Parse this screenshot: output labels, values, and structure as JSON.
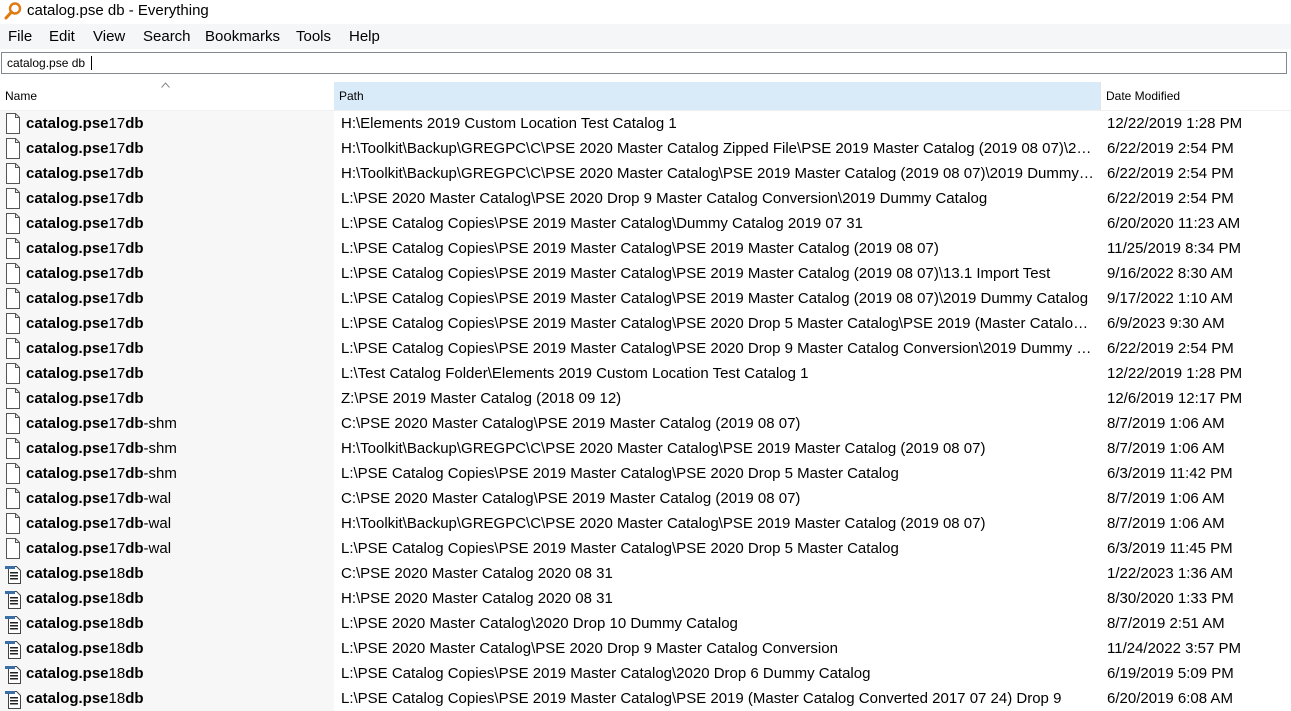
{
  "window": {
    "title": "catalog.pse db - Everything"
  },
  "menu": [
    "File",
    "Edit",
    "View",
    "Search",
    "Bookmarks",
    "Tools",
    "Help"
  ],
  "search": {
    "value": "catalog.pse db"
  },
  "columns": {
    "name": "Name",
    "path": "Path",
    "date": "Date Modified"
  },
  "sort": {
    "column": "Name",
    "direction": "ascending"
  },
  "icons": {
    "app": "magnifier-icon",
    "file": "file-icon",
    "db_file": "database-file-icon"
  },
  "rows": [
    {
      "prefix": "catalog.pse",
      "mid": "17",
      "suffix": "db",
      "tail": "",
      "icon": "file",
      "path": "H:\\Elements 2019 Custom Location Test Catalog 1",
      "date": "12/22/2019 1:28 PM"
    },
    {
      "prefix": "catalog.pse",
      "mid": "17",
      "suffix": "db",
      "tail": "",
      "icon": "file",
      "path": "H:\\Toolkit\\Backup\\GREGPC\\C\\PSE 2020 Master Catalog Zipped File\\PSE 2019 Master Catalog (2019 08 07)\\2019 ...",
      "date": "6/22/2019 2:54 PM"
    },
    {
      "prefix": "catalog.pse",
      "mid": "17",
      "suffix": "db",
      "tail": "",
      "icon": "file",
      "path": "H:\\Toolkit\\Backup\\GREGPC\\C\\PSE 2020 Master Catalog\\PSE 2019 Master Catalog (2019 08 07)\\2019 Dummy Cat...",
      "date": "6/22/2019 2:54 PM"
    },
    {
      "prefix": "catalog.pse",
      "mid": "17",
      "suffix": "db",
      "tail": "",
      "icon": "file",
      "path": "L:\\PSE 2020 Master Catalog\\PSE 2020 Drop 9 Master Catalog Conversion\\2019 Dummy Catalog",
      "date": "6/22/2019 2:54 PM"
    },
    {
      "prefix": "catalog.pse",
      "mid": "17",
      "suffix": "db",
      "tail": "",
      "icon": "file",
      "path": "L:\\PSE Catalog Copies\\PSE 2019 Master Catalog\\Dummy Catalog 2019 07 31",
      "date": "6/20/2020 11:23 AM"
    },
    {
      "prefix": "catalog.pse",
      "mid": "17",
      "suffix": "db",
      "tail": "",
      "icon": "file",
      "path": "L:\\PSE Catalog Copies\\PSE 2019 Master Catalog\\PSE 2019 Master Catalog (2019 08 07)",
      "date": "11/25/2019 8:34 PM"
    },
    {
      "prefix": "catalog.pse",
      "mid": "17",
      "suffix": "db",
      "tail": "",
      "icon": "file",
      "path": "L:\\PSE Catalog Copies\\PSE 2019 Master Catalog\\PSE 2019 Master Catalog (2019 08 07)\\13.1 Import Test",
      "date": "9/16/2022 8:30 AM"
    },
    {
      "prefix": "catalog.pse",
      "mid": "17",
      "suffix": "db",
      "tail": "",
      "icon": "file",
      "path": "L:\\PSE Catalog Copies\\PSE 2019 Master Catalog\\PSE 2019 Master Catalog (2019 08 07)\\2019 Dummy Catalog",
      "date": "9/17/2022 1:10 AM"
    },
    {
      "prefix": "catalog.pse",
      "mid": "17",
      "suffix": "db",
      "tail": "",
      "icon": "file",
      "path": "L:\\PSE Catalog Copies\\PSE 2019 Master Catalog\\PSE 2020 Drop 5 Master Catalog\\PSE 2019 (Master Catalog Con...",
      "date": "6/9/2023 9:30 AM"
    },
    {
      "prefix": "catalog.pse",
      "mid": "17",
      "suffix": "db",
      "tail": "",
      "icon": "file",
      "path": "L:\\PSE Catalog Copies\\PSE 2019 Master Catalog\\PSE 2020 Drop 9 Master Catalog Conversion\\2019 Dummy Catal...",
      "date": "6/22/2019 2:54 PM"
    },
    {
      "prefix": "catalog.pse",
      "mid": "17",
      "suffix": "db",
      "tail": "",
      "icon": "file",
      "path": "L:\\Test Catalog Folder\\Elements 2019 Custom Location Test Catalog 1",
      "date": "12/22/2019 1:28 PM"
    },
    {
      "prefix": "catalog.pse",
      "mid": "17",
      "suffix": "db",
      "tail": "",
      "icon": "file",
      "path": "Z:\\PSE 2019 Master Catalog (2018 09 12)",
      "date": "12/6/2019 12:17 PM"
    },
    {
      "prefix": "catalog.pse",
      "mid": "17",
      "suffix": "db",
      "tail": "-shm",
      "icon": "file",
      "path": "C:\\PSE 2020 Master Catalog\\PSE 2019 Master Catalog (2019 08 07)",
      "date": "8/7/2019 1:06 AM"
    },
    {
      "prefix": "catalog.pse",
      "mid": "17",
      "suffix": "db",
      "tail": "-shm",
      "icon": "file",
      "path": "H:\\Toolkit\\Backup\\GREGPC\\C\\PSE 2020 Master Catalog\\PSE 2019 Master Catalog (2019 08 07)",
      "date": "8/7/2019 1:06 AM"
    },
    {
      "prefix": "catalog.pse",
      "mid": "17",
      "suffix": "db",
      "tail": "-shm",
      "icon": "file",
      "path": "L:\\PSE Catalog Copies\\PSE 2019 Master Catalog\\PSE 2020 Drop 5 Master Catalog",
      "date": "6/3/2019 11:42 PM"
    },
    {
      "prefix": "catalog.pse",
      "mid": "17",
      "suffix": "db",
      "tail": "-wal",
      "icon": "file",
      "path": "C:\\PSE 2020 Master Catalog\\PSE 2019 Master Catalog (2019 08 07)",
      "date": "8/7/2019 1:06 AM"
    },
    {
      "prefix": "catalog.pse",
      "mid": "17",
      "suffix": "db",
      "tail": "-wal",
      "icon": "file",
      "path": "H:\\Toolkit\\Backup\\GREGPC\\C\\PSE 2020 Master Catalog\\PSE 2019 Master Catalog (2019 08 07)",
      "date": "8/7/2019 1:06 AM"
    },
    {
      "prefix": "catalog.pse",
      "mid": "17",
      "suffix": "db",
      "tail": "-wal",
      "icon": "file",
      "path": "L:\\PSE Catalog Copies\\PSE 2019 Master Catalog\\PSE 2020 Drop 5 Master Catalog",
      "date": "6/3/2019 11:45 PM"
    },
    {
      "prefix": "catalog.pse",
      "mid": "18",
      "suffix": "db",
      "tail": "",
      "icon": "db_file",
      "path": "C:\\PSE 2020 Master Catalog 2020 08 31",
      "date": "1/22/2023 1:36 AM"
    },
    {
      "prefix": "catalog.pse",
      "mid": "18",
      "suffix": "db",
      "tail": "",
      "icon": "db_file",
      "path": "H:\\PSE 2020 Master Catalog 2020 08 31",
      "date": "8/30/2020 1:33 PM"
    },
    {
      "prefix": "catalog.pse",
      "mid": "18",
      "suffix": "db",
      "tail": "",
      "icon": "db_file",
      "path": "L:\\PSE 2020 Master Catalog\\2020 Drop 10 Dummy Catalog",
      "date": "8/7/2019 2:51 AM"
    },
    {
      "prefix": "catalog.pse",
      "mid": "18",
      "suffix": "db",
      "tail": "",
      "icon": "db_file",
      "path": "L:\\PSE 2020 Master Catalog\\PSE 2020 Drop 9 Master Catalog Conversion",
      "date": "11/24/2022 3:57 PM"
    },
    {
      "prefix": "catalog.pse",
      "mid": "18",
      "suffix": "db",
      "tail": "",
      "icon": "db_file",
      "path": "L:\\PSE Catalog Copies\\PSE 2019 Master Catalog\\2020 Drop 6 Dummy Catalog",
      "date": "6/19/2019 5:09 PM"
    },
    {
      "prefix": "catalog.pse",
      "mid": "18",
      "suffix": "db",
      "tail": "",
      "icon": "db_file",
      "path": "L:\\PSE Catalog Copies\\PSE 2019 Master Catalog\\PSE 2019 (Master Catalog Converted 2017 07 24) Drop 9",
      "date": "6/20/2019 6:08 AM"
    }
  ]
}
